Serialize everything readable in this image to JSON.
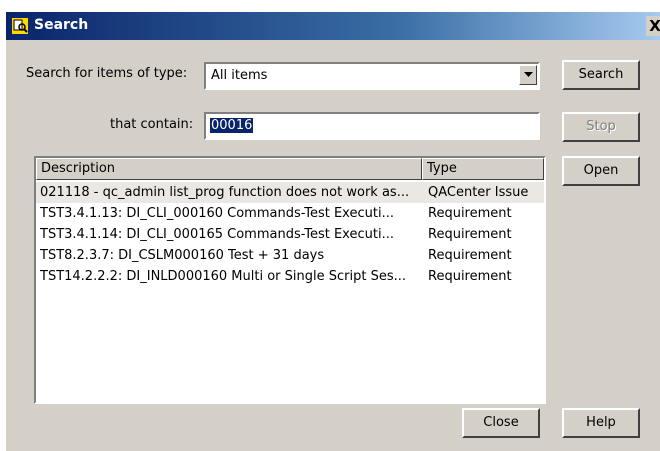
{
  "title": "Search",
  "close_glyph": "X",
  "search_type_label": "Search for items of type:",
  "search_type_value": "All items",
  "contain_label": "that contain:",
  "contain_value": "00016",
  "buttons": {
    "search": "Search",
    "stop": "Stop",
    "open": "Open",
    "close": "Close",
    "help": "Help"
  },
  "table": {
    "columns": [
      "Description",
      "Type"
    ],
    "rows": [
      {
        "description": "021118 - qc_admin list_prog function does not work as...",
        "type": "QACenter Issue"
      },
      {
        "description": "TST3.4.1.13: DI_CLI_000160 Commands-Test Executi...",
        "type": "Requirement"
      },
      {
        "description": "TST3.4.1.14: DI_CLI_000165 Commands-Test Executi...",
        "type": "Requirement"
      },
      {
        "description": "TST8.2.3.7: DI_CSLM000160 Test + 31 days",
        "type": "Requirement"
      },
      {
        "description": "TST14.2.2.2: DI_INLD000160 Multi or Single Script Ses...",
        "type": "Requirement"
      }
    ]
  },
  "colors": {
    "title_bar": "#0a246a",
    "dialog_face": "#d4d0c8",
    "selection": "#0a246a"
  }
}
